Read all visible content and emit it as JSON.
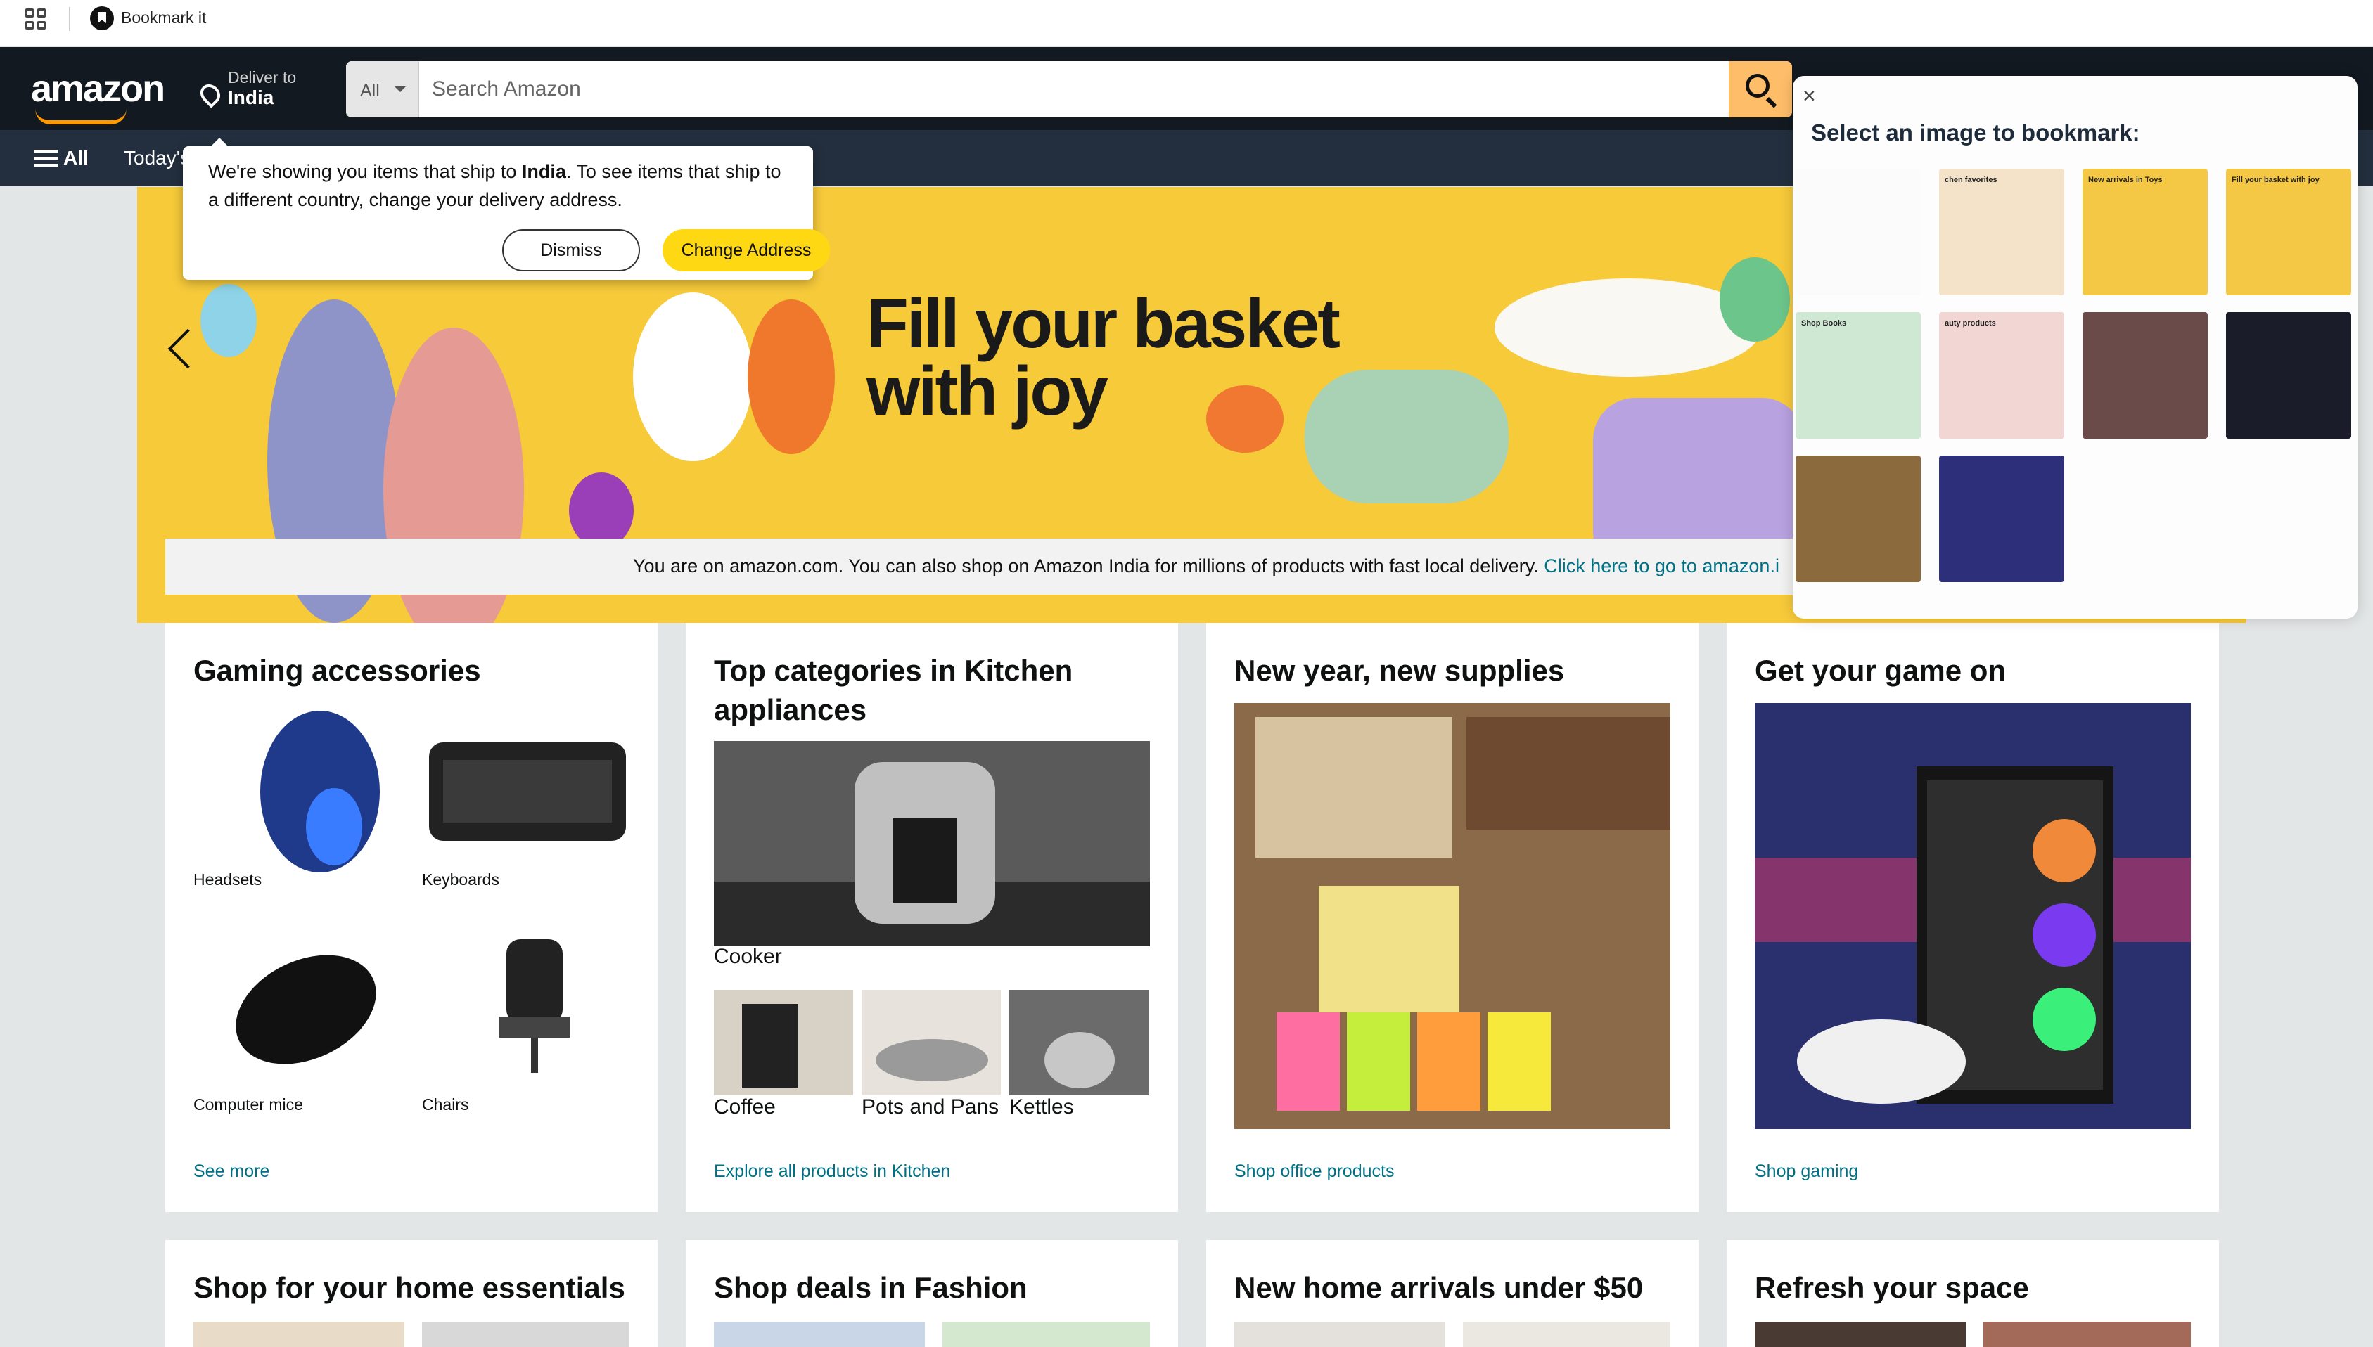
{
  "extension_bar": {
    "label": "Bookmark it"
  },
  "nav": {
    "logo": "amazon",
    "deliver_line1": "Deliver to",
    "deliver_line2": "India",
    "search_category": "All",
    "search_placeholder": "Search Amazon",
    "all_label": "All",
    "today_label": "Today's"
  },
  "popover": {
    "msg_part1": "We're showing you items that ship to ",
    "msg_country": "India",
    "msg_part2": ". To see items that ship to a different country, change your delivery address.",
    "dismiss": "Dismiss",
    "change": "Change Address"
  },
  "hero": {
    "title": "Fill your basket\nwith joy",
    "notice_text": "You are on amazon.com. You can also shop on Amazon India for millions of products with fast local delivery. ",
    "notice_link": "Click here to go to amazon.i"
  },
  "cards": {
    "gaming": {
      "title": "Gaming accessories",
      "tiles": [
        "Headsets",
        "Keyboards",
        "Computer mice",
        "Chairs"
      ],
      "link": "See more"
    },
    "kitchen": {
      "title": "Top categories in Kitchen appliances",
      "main_caption": "Cooker",
      "tiles": [
        "Coffee",
        "Pots and Pans",
        "Kettles"
      ],
      "link": "Explore all products in Kitchen"
    },
    "supplies": {
      "title": "New year, new supplies",
      "link": "Shop office products"
    },
    "game": {
      "title": "Get your game on",
      "link": "Shop gaming"
    },
    "row2": [
      "Shop for your home essentials",
      "Shop deals in Fashion",
      "New home arrivals under $50",
      "Refresh your space"
    ]
  },
  "bookmark_panel": {
    "close": "×",
    "title": "Select an image to bookmark:",
    "thumb_labels": [
      "",
      "chen favorites",
      "New arrivals in Toys",
      "Fill your basket with joy",
      "Shop Books",
      "auty products",
      "",
      "",
      "",
      ""
    ],
    "thumb_colors": [
      "#fbfbfb",
      "#f4e3c9",
      "#f4c845",
      "#f4c845",
      "#cfe8d4",
      "#f2d6d3",
      "#6b4a4a",
      "#1a1c2a",
      "#8b6a3d",
      "#2d2f7a"
    ]
  },
  "colors": {
    "nav_dark": "#131921",
    "nav_secondary": "#232f3e",
    "accent": "#febd69",
    "link": "#007185",
    "hero_yellow": "#f7ca3a"
  }
}
